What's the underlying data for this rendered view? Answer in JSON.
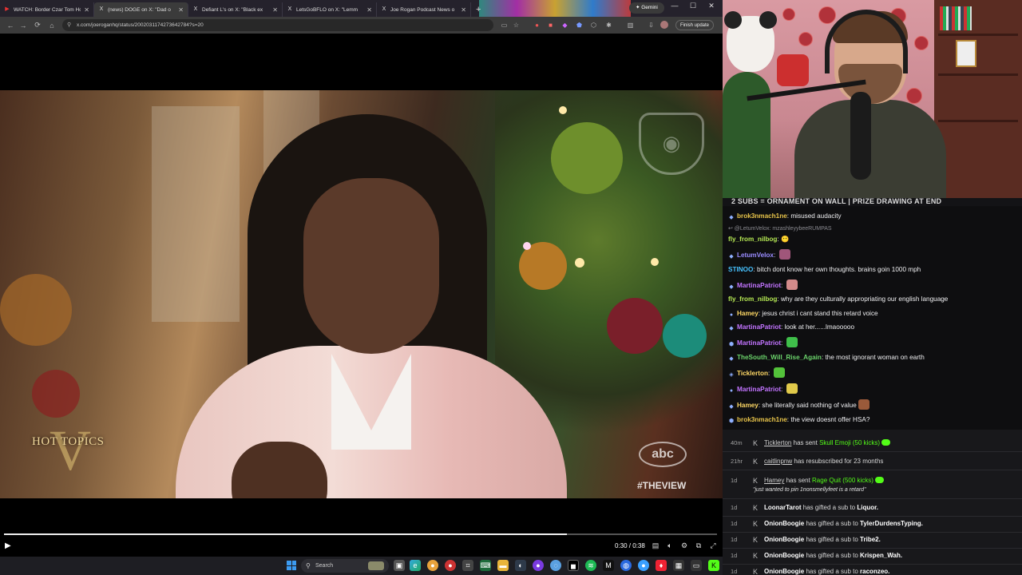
{
  "browser": {
    "tabs": [
      {
        "icon": "play-icon",
        "glyph": "▶",
        "title": "WATCH: Border Czar Tom Hom",
        "active": false
      },
      {
        "icon": "x-logo-icon",
        "glyph": "X",
        "title": "(news) DOGE on X: \"Dad o",
        "active": true
      },
      {
        "icon": "x-logo-icon",
        "glyph": "X",
        "title": "Defiant L's on X: \"Black ex",
        "active": false
      },
      {
        "icon": "x-logo-icon",
        "glyph": "X",
        "title": "LetsGoBFLO on X: \"Lemm",
        "active": false
      },
      {
        "icon": "x-logo-icon",
        "glyph": "X",
        "title": "Joe Rogan Podcast News o",
        "active": false
      }
    ],
    "new_tab": "+",
    "gemini_label": "✦ Gemini",
    "url": "x.com/joeroganhq/status/2002031174273642784?s=20",
    "finish_update": "Finish update"
  },
  "video": {
    "overlay_hot_topics": "HOT TOPICS",
    "overlay_v": "V",
    "network_logo": "abc",
    "hashtag": "#THEVIEW"
  },
  "player": {
    "progress": 0.79,
    "time": "0:30 / 0:38"
  },
  "taskbar": {
    "search_label": "Search"
  },
  "stream": {
    "banner": "2 SUBS = ORNAMENT ON WALL | PRIZE DRAWING AT END"
  },
  "chat": {
    "messages": [
      {
        "user": "brok3nmach1ne",
        "color": "#e8c44a",
        "text": "misused audacity",
        "emote": ""
      },
      {
        "reply": "↩ @LetumVelox: mzashleyybeeRUMPAS"
      },
      {
        "user": "fly_from_nilbog",
        "color": "#b5e853",
        "text": "😶",
        "emote": ""
      },
      {
        "user": "LetumVelox",
        "color": "#9a8cff",
        "text": "",
        "emote": "#a0567a"
      },
      {
        "user": "STINOO",
        "color": "#47c2ff",
        "text": "bitch dont know her own thoughts. brains goin 1000 mph",
        "emote": ""
      },
      {
        "user": "MartinaPatriot",
        "color": "#c274ff",
        "text": "",
        "emote": "#d38a8a"
      },
      {
        "user": "fly_from_nilbog",
        "color": "#b5e853",
        "text": "why are they culturally appropriating our english language",
        "emote": ""
      },
      {
        "user": "Hamey",
        "color": "#ffd966",
        "text": "jesus christ i cant stand this retard voice",
        "emote": ""
      },
      {
        "user": "MartinaPatriot",
        "color": "#c274ff",
        "text": "look at her......lmaooooo",
        "emote": ""
      },
      {
        "user": "MartinaPatriot",
        "color": "#c274ff",
        "text": "",
        "emote": "#3fbf4a"
      },
      {
        "user": "TheSouth_Will_Rise_Again",
        "color": "#6bd36b",
        "text": "the most ignorant woman on earth",
        "emote": ""
      },
      {
        "user": "Ticklerton",
        "color": "#ffd966",
        "text": "",
        "emote": "#53c23a"
      },
      {
        "user": "MartinaPatriot",
        "color": "#c274ff",
        "text": "",
        "emote": "#e0c94a"
      },
      {
        "user": "Hamey",
        "color": "#ffd966",
        "text": "she literally said nothing of value",
        "emote": "#9a5a3a"
      },
      {
        "user": "brok3nmach1ne",
        "color": "#e8c44a",
        "text": "the view doesnt offer HSA?",
        "emote": ""
      }
    ]
  },
  "events": {
    "items": [
      {
        "age": "40m",
        "user": "Ticklerton",
        "action": "has sent",
        "item": "Skull Emoji (50 kicks)",
        "pill": true,
        "quote": ""
      },
      {
        "age": "21hr",
        "user": "caitlinpnw",
        "action": "has resubscribed for 23 months",
        "item": "",
        "pill": false,
        "quote": ""
      },
      {
        "age": "1d",
        "user": "Hamey",
        "action": "has sent",
        "item": "Rage Quit (500 kicks)",
        "pill": true,
        "quote": "\"just wanted to pin 1nonsmellyfeet is a retard\""
      },
      {
        "age": "1d",
        "user": "LoonarTarot",
        "action": "has gifted a sub to",
        "target": "Liquor.",
        "gift": true
      },
      {
        "age": "1d",
        "user": "OnionBoogie",
        "action": "has gifted a sub to",
        "target": "TylerDurdensTyping.",
        "gift": true
      },
      {
        "age": "1d",
        "user": "OnionBoogie",
        "action": "has gifted a sub to",
        "target": "Tribe2.",
        "gift": true
      },
      {
        "age": "1d",
        "user": "OnionBoogie",
        "action": "has gifted a sub to",
        "target": "Krispen_Wah.",
        "gift": true
      },
      {
        "age": "1d",
        "user": "OnionBoogie",
        "action": "has gifted a sub to",
        "target": "raconzeo.",
        "gift": true
      }
    ]
  },
  "colors": {
    "kick_green": "#53fc18",
    "chat_bg": "#0e0e10",
    "events_bg": "#18181b"
  }
}
